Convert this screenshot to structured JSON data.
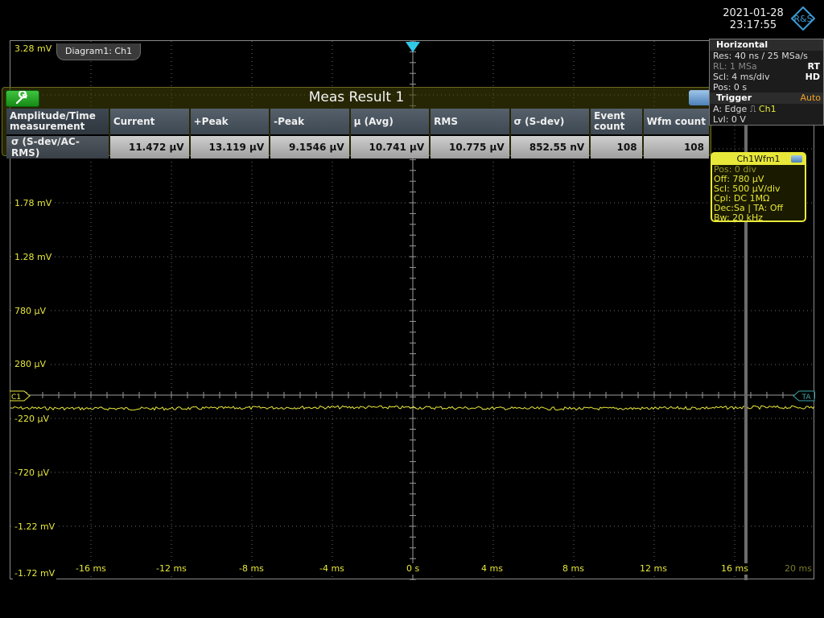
{
  "status": {
    "date": "2021-01-28",
    "time": "23:17:55",
    "logo": "rs-diamond-logo"
  },
  "diagram": {
    "tab_label": "Diagram1: Ch1",
    "y_ticks": [
      "3.28 mV",
      "1.78 mV",
      "1.28 mV",
      "780 µV",
      "280 µV",
      "-220 µV",
      "-720 µV",
      "-1.22 mV",
      "-1.72 mV"
    ],
    "x_ticks": [
      "-16 ms",
      "-12 ms",
      "-8 ms",
      "-4 ms",
      "0 s",
      "4 ms",
      "8 ms",
      "12 ms",
      "16 ms",
      "20 ms"
    ],
    "channel_marker": "C1",
    "ta_marker": "TA",
    "colors": {
      "trace": "#e8e83a",
      "grid": "#6a6a6a",
      "ta": "#3aa6a6"
    }
  },
  "meas_result": {
    "title": "Meas Result 1",
    "columns": [
      "Amplitude/Time measurement",
      "Current",
      "+Peak",
      "-Peak",
      "μ (Avg)",
      "RMS",
      "σ (S-dev)",
      "Event count",
      "Wfm count"
    ],
    "row": [
      "σ (S-dev/AC-RMS)",
      "11.472 μV",
      "13.119 μV",
      "9.1546 μV",
      "10.741 μV",
      "10.775 μV",
      "852.55 nV",
      "108",
      "108"
    ]
  },
  "horizontal": {
    "title": "Horizontal",
    "res": "Res: 40 ns / 25 MSa/s",
    "rl": "RL:  1 MSa",
    "rt": "RT",
    "scl": "Scl:  4 ms/div",
    "hd": "HD",
    "pos": "Pos: 0 s"
  },
  "trigger": {
    "title": "Trigger",
    "mode": "Auto",
    "a": "A:    Edge",
    "source": "Ch1",
    "lvl": "Lvl:  0 V"
  },
  "wfm_box": {
    "title": "Ch1Wfm1",
    "pos": "Pos: 0 div",
    "off": "Off: 780 μV",
    "scl": "Scl: 500 μV/div",
    "cpl": "Cpl: DC 1MΩ",
    "dec": "Dec:Sa | TA: Off",
    "bw": "Bw: 20 kHz"
  }
}
